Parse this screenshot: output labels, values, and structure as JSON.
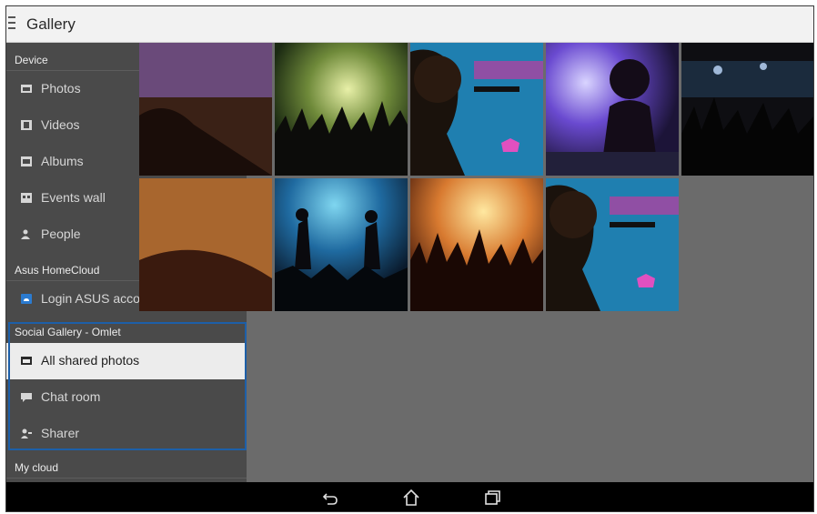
{
  "app": {
    "title": "Gallery"
  },
  "drawer": {
    "sections": [
      {
        "title": "Device",
        "items": [
          {
            "label": "Photos",
            "icon": "photos-icon"
          },
          {
            "label": "Videos",
            "icon": "videos-icon"
          },
          {
            "label": "Albums",
            "icon": "albums-icon"
          },
          {
            "label": "Events wall",
            "icon": "events-wall-icon"
          },
          {
            "label": "People",
            "icon": "people-icon"
          }
        ]
      },
      {
        "title": "Asus HomeCloud",
        "items": [
          {
            "label": "Login ASUS account",
            "icon": "cloud-login-icon"
          }
        ]
      },
      {
        "title": "Social Gallery - Omlet",
        "items": [
          {
            "label": "All shared photos",
            "icon": "shared-photos-icon",
            "selected": true
          },
          {
            "label": "Chat room",
            "icon": "chat-icon"
          },
          {
            "label": "Sharer",
            "icon": "sharer-icon"
          }
        ]
      },
      {
        "title": "My cloud",
        "items": []
      }
    ]
  },
  "gallery": {
    "thumbnails": [
      {
        "icon": "concert-photo",
        "scene": "crowd-edge"
      },
      {
        "icon": "concert-photo",
        "scene": "crowd-hands-green"
      },
      {
        "icon": "concert-photo",
        "scene": "singer-microphone-blue"
      },
      {
        "icon": "concert-photo",
        "scene": "dj-purple"
      },
      {
        "icon": "concert-photo",
        "scene": "crowd-dark-lights"
      },
      {
        "icon": "concert-photo",
        "scene": "crowd-edge-orange"
      },
      {
        "icon": "concert-photo",
        "scene": "band-stage-blue"
      },
      {
        "icon": "concert-photo",
        "scene": "crowd-hands-orange"
      },
      {
        "icon": "concert-photo",
        "scene": "singer-microphone-blue"
      }
    ]
  },
  "navbar": {
    "buttons": [
      "back-icon",
      "home-icon",
      "recent-apps-icon"
    ]
  },
  "colors": {
    "highlight_border": "#1d5fa8",
    "drawer_bg": "#4a4a4a",
    "selected_bg": "#ececec"
  }
}
